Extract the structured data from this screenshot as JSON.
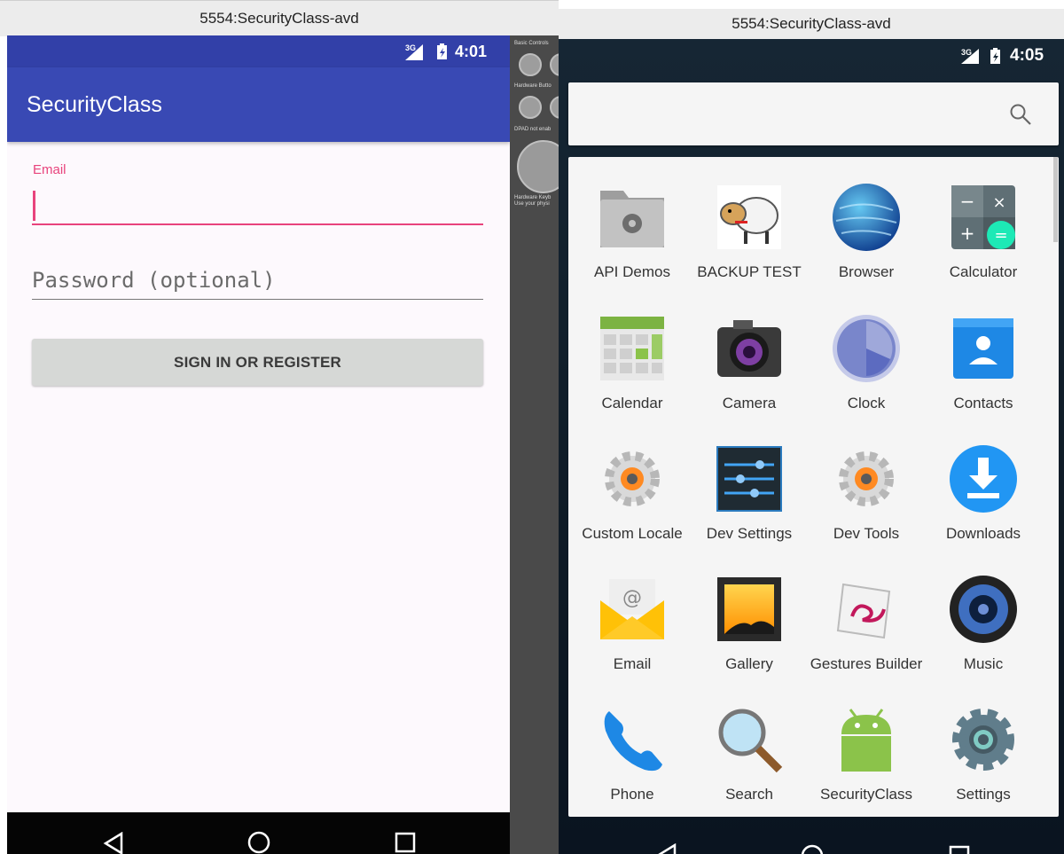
{
  "left_window": {
    "title": "5554:SecurityClass-avd",
    "status_time": "4:01",
    "network": "3G",
    "app_title": "SecurityClass",
    "email_label": "Email",
    "email_value": "",
    "password_placeholder": "Password (optional)",
    "signin_label": "SIGN IN OR REGISTER"
  },
  "side_panel": {
    "labels": [
      "Basic Controls",
      "Hardware Butto",
      "DPAD not enab",
      "Hardware Keyb",
      "Use your physi"
    ]
  },
  "right_window": {
    "title": "5554:SecurityClass-avd",
    "status_time": "4:05",
    "network": "3G",
    "apps": [
      {
        "label": "API Demos",
        "icon": "folder-gear-icon"
      },
      {
        "label": "BACKUP TEST",
        "icon": "sheep-icon"
      },
      {
        "label": "Browser",
        "icon": "globe-icon"
      },
      {
        "label": "Calculator",
        "icon": "calculator-icon"
      },
      {
        "label": "Calendar",
        "icon": "calendar-icon"
      },
      {
        "label": "Camera",
        "icon": "camera-icon"
      },
      {
        "label": "Clock",
        "icon": "clock-icon"
      },
      {
        "label": "Contacts",
        "icon": "contacts-icon"
      },
      {
        "label": "Custom Locale",
        "icon": "gear-icon"
      },
      {
        "label": "Dev Settings",
        "icon": "sliders-icon"
      },
      {
        "label": "Dev Tools",
        "icon": "gear-icon"
      },
      {
        "label": "Downloads",
        "icon": "download-icon"
      },
      {
        "label": "Email",
        "icon": "email-icon"
      },
      {
        "label": "Gallery",
        "icon": "gallery-icon"
      },
      {
        "label": "Gestures Builder",
        "icon": "gestures-icon"
      },
      {
        "label": "Music",
        "icon": "speaker-icon"
      },
      {
        "label": "Phone",
        "icon": "phone-icon"
      },
      {
        "label": "Search",
        "icon": "magnifier-icon"
      },
      {
        "label": "SecurityClass",
        "icon": "android-icon"
      },
      {
        "label": "Settings",
        "icon": "settings-icon"
      }
    ]
  },
  "colors": {
    "primary": "#3949b4",
    "primary_dark": "#3240a8",
    "accent": "#e8447d",
    "button": "#d6d8d6"
  }
}
